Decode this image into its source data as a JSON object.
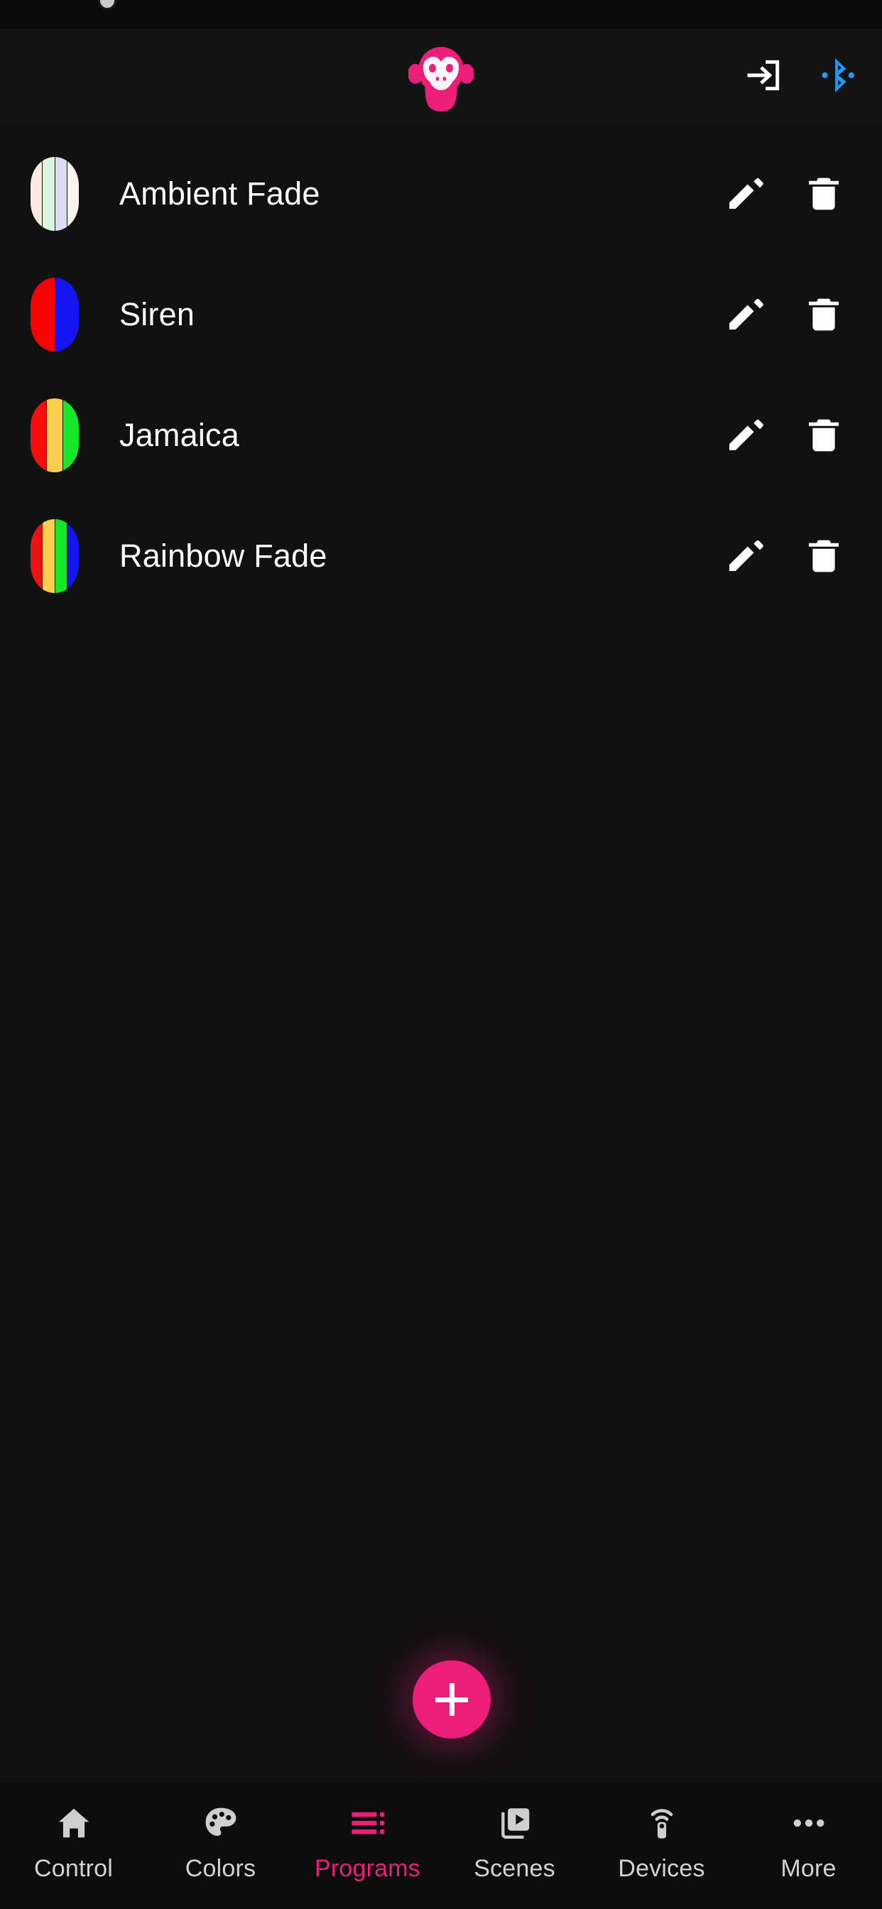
{
  "app": {
    "background_color": "#111111",
    "accent_color": "#ED1E79",
    "bluetooth_color": "#2196F3"
  },
  "header": {
    "logo_name": "monkey-logo",
    "logo_color": "#ED1E79",
    "actions": [
      {
        "name": "login-icon",
        "label": "Login"
      },
      {
        "name": "bluetooth-icon",
        "label": "Bluetooth"
      }
    ]
  },
  "programs": {
    "items": [
      {
        "name": "Ambient Fade",
        "colors": [
          "#FCE9E2",
          "#DDF4DF",
          "#DCDCF6",
          "#FDF3EC"
        ],
        "edit_label": "Edit",
        "delete_label": "Delete"
      },
      {
        "name": "Siren",
        "colors": [
          "#FA0000",
          "#1414F0"
        ],
        "edit_label": "Edit",
        "delete_label": "Delete"
      },
      {
        "name": "Jamaica",
        "colors": [
          "#FA0C0C",
          "#F8CF4E",
          "#17E82A"
        ],
        "edit_label": "Edit",
        "delete_label": "Delete"
      },
      {
        "name": "Rainbow Fade",
        "colors": [
          "#E81414",
          "#F8CF4E",
          "#14E82A",
          "#1414EE"
        ],
        "edit_label": "Edit",
        "delete_label": "Delete"
      }
    ]
  },
  "fab": {
    "label": "+",
    "name": "add-program-button",
    "color": "#ED1E79"
  },
  "bottom_nav": {
    "active_index": 2,
    "items": [
      {
        "label": "Control",
        "icon": "home-icon"
      },
      {
        "label": "Colors",
        "icon": "palette-icon"
      },
      {
        "label": "Programs",
        "icon": "list-icon"
      },
      {
        "label": "Scenes",
        "icon": "video-library-icon"
      },
      {
        "label": "Devices",
        "icon": "remote-control-icon"
      },
      {
        "label": "More",
        "icon": "more-horizontal-icon"
      }
    ]
  }
}
